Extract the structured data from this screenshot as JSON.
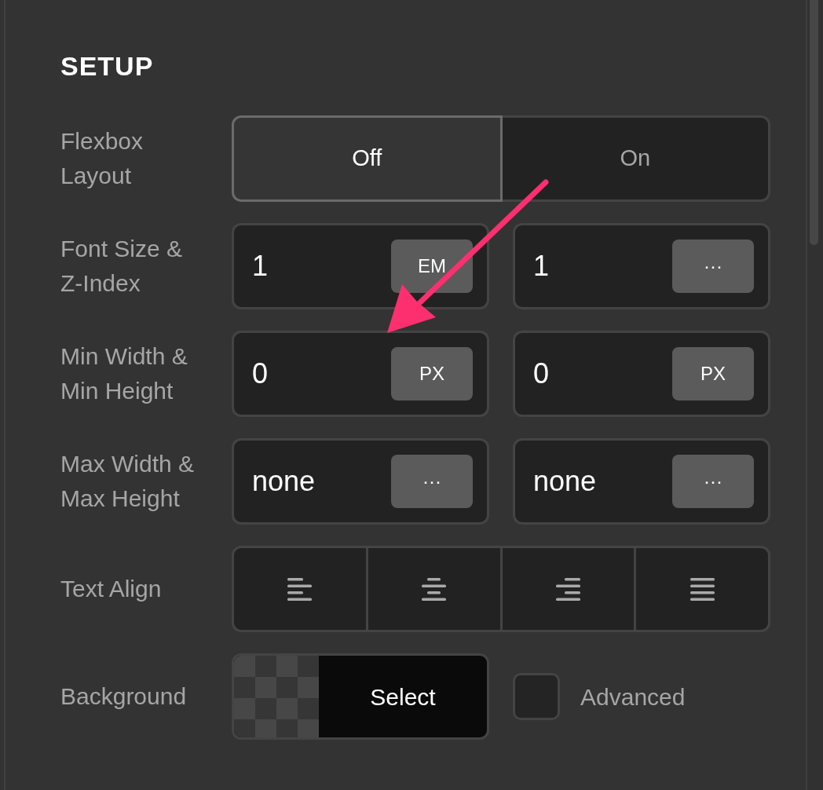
{
  "section": {
    "title": "SETUP"
  },
  "rows": [
    {
      "kind": "toggle",
      "label": "Flexbox Layout",
      "options": [
        {
          "label": "Off",
          "selected": true
        },
        {
          "label": "On",
          "selected": false
        }
      ]
    },
    {
      "kind": "pair",
      "label": "Font Size & Z-Index",
      "fields": [
        {
          "value": "1",
          "unit": "EM"
        },
        {
          "value": "1",
          "unit": "···"
        }
      ]
    },
    {
      "kind": "pair",
      "label": "Min Width & Min Height",
      "fields": [
        {
          "value": "0",
          "unit": "PX"
        },
        {
          "value": "0",
          "unit": "PX"
        }
      ]
    },
    {
      "kind": "pair",
      "label": "Max Width & Max Height",
      "fields": [
        {
          "value": "none",
          "unit": "···"
        },
        {
          "value": "none",
          "unit": "···"
        }
      ]
    },
    {
      "kind": "align",
      "label": "Text Align",
      "options": [
        {
          "kind": "left",
          "selected": false
        },
        {
          "kind": "center",
          "selected": false
        },
        {
          "kind": "right",
          "selected": false
        },
        {
          "kind": "justify",
          "selected": false
        }
      ]
    },
    {
      "kind": "background",
      "label": "Background",
      "button": "Select",
      "checkbox": {
        "label": "Advanced",
        "checked": false
      }
    }
  ]
}
